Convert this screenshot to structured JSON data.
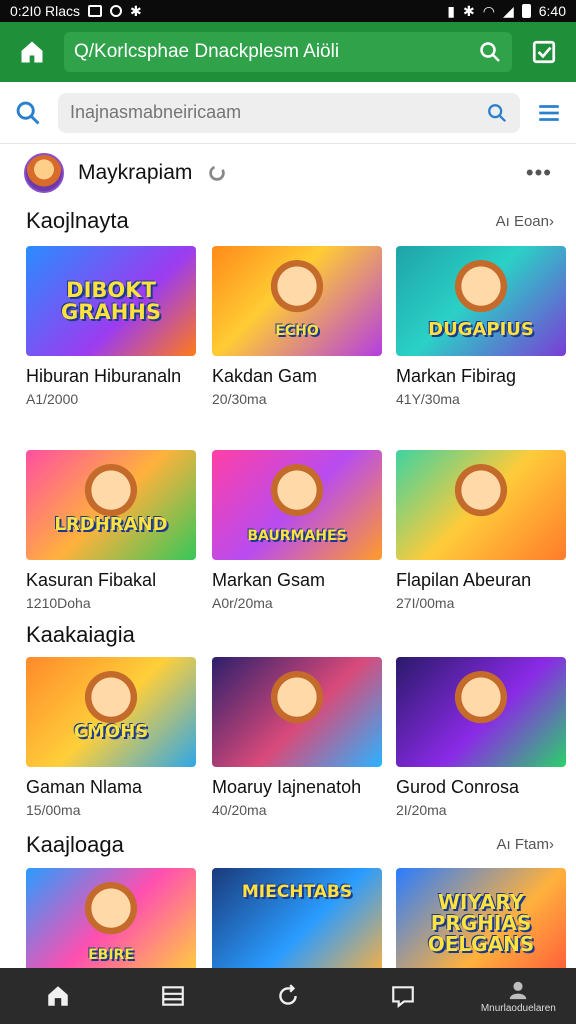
{
  "status_bar": {
    "time_left": "0:2I0 Rlacs",
    "time_right": "6:40"
  },
  "header": {
    "url": "Q/Korlcsphae Dnackplesm Aiöli"
  },
  "search": {
    "placeholder": "Inajnasmabneiricaam"
  },
  "profile": {
    "name": "Maykrapiam",
    "more": "•••"
  },
  "sections": [
    {
      "title": "Kaojlnayta",
      "see_all": "Aı Eoan›",
      "cards": [
        {
          "title": "Hiburan Hiburanaln",
          "sub": "A1/2000",
          "art": "DIBOKT GRAHHS",
          "style": "g1"
        },
        {
          "title": "Kakdan Gam",
          "sub": "20/30ma",
          "art": "ECHO",
          "style": "g2"
        },
        {
          "title": "Markan Fibirag",
          "sub": "41Y/30ma",
          "art": "DUGAPIUS",
          "style": "g3"
        }
      ]
    },
    {
      "title": "",
      "see_all": "",
      "cards": [
        {
          "title": "Kasuran Fibakal",
          "sub": "1210Doha",
          "art": "LRDHRAND",
          "style": "g4"
        },
        {
          "title": "Markan Gsam",
          "sub": "A0r/20ma",
          "art": "BAURMAHES",
          "style": "g5"
        },
        {
          "title": "Flapilan Abeuran",
          "sub": "27I/00ma",
          "art": "",
          "style": "g6"
        }
      ]
    },
    {
      "title": "Kaakaiagia",
      "see_all": "",
      "cards": [
        {
          "title": "Gaman Nlama",
          "sub": "15/00ma",
          "art": "CMOHS",
          "style": "g7"
        },
        {
          "title": "Moaruy Iajnenatoh",
          "sub": "40/20ma",
          "art": "",
          "style": "g8"
        },
        {
          "title": "Gurod Conrosa",
          "sub": "2I/20ma",
          "art": "",
          "style": "g9"
        }
      ]
    },
    {
      "title": "Kaajloaga",
      "see_all": "Aı Ftam›",
      "cards": [
        {
          "title": "",
          "sub": "",
          "art": "EBIRE",
          "style": "g10"
        },
        {
          "title": "",
          "sub": "",
          "art": "MIECHTABS",
          "style": "g11"
        },
        {
          "title": "",
          "sub": "",
          "art": "WIYARY PRGHIAS OELGANS",
          "style": "g12"
        }
      ]
    }
  ],
  "bottom_nav": {
    "last_label": "Mnurlaoduelaren"
  }
}
